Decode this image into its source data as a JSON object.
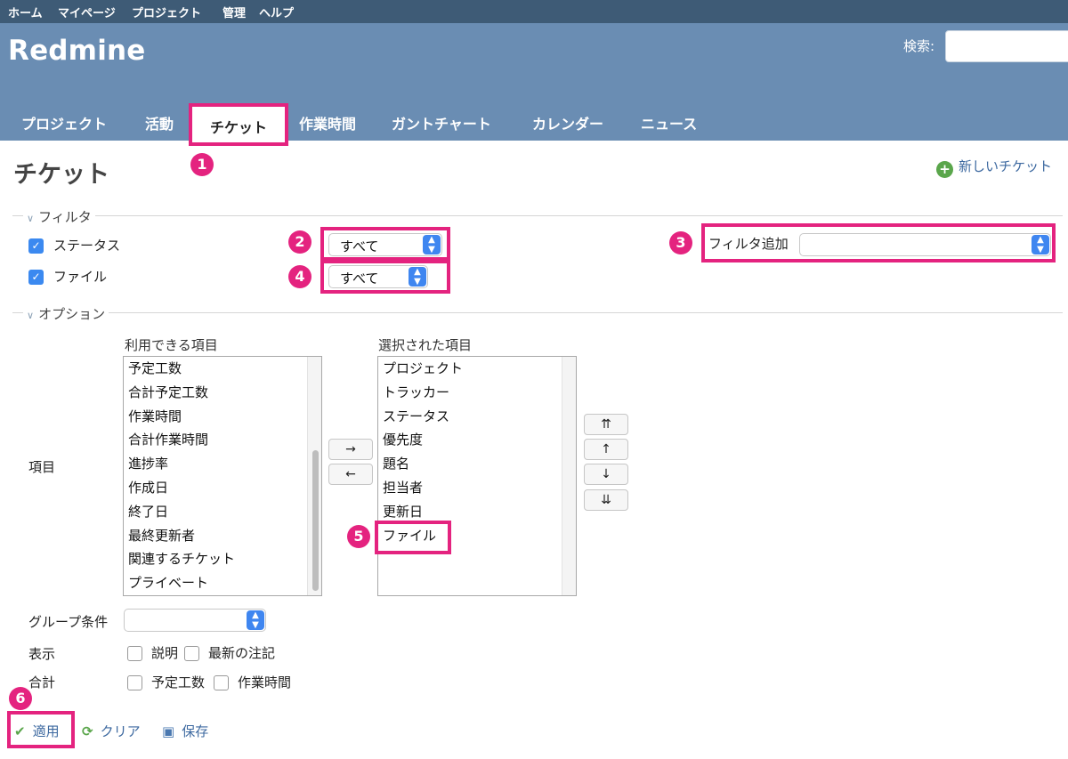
{
  "top_menu": {
    "home": "ホーム",
    "my_page": "マイページ",
    "projects": "プロジェクト",
    "admin": "管理",
    "help": "ヘルプ"
  },
  "header": {
    "title": "Redmine",
    "search_label": "検索:",
    "search_value": ""
  },
  "main_menu": {
    "projects": "プロジェクト",
    "activity": "活動",
    "issues": "チケット",
    "time_entries": "作業時間",
    "gantt": "ガントチャート",
    "calendar": "カレンダー",
    "news": "ニュース",
    "selected": "チケット"
  },
  "page": {
    "title": "チケット",
    "new_issue": "新しいチケット"
  },
  "filters": {
    "legend": "フィルタ",
    "status": {
      "label": "ステータス",
      "checked": true,
      "operator": "すべて"
    },
    "file": {
      "label": "ファイル",
      "checked": true,
      "operator": "すべて"
    },
    "add_filter_label": "フィルタ追加",
    "add_filter_value": ""
  },
  "options": {
    "legend": "オプション",
    "columns_label": "項目",
    "available_heading": "利用できる項目",
    "selected_heading": "選択された項目",
    "available": [
      "予定工数",
      "合計予定工数",
      "作業時間",
      "合計作業時間",
      "進捗率",
      "作成日",
      "終了日",
      "最終更新者",
      "関連するチケット",
      "プライベート"
    ],
    "selected": [
      "プロジェクト",
      "トラッカー",
      "ステータス",
      "優先度",
      "題名",
      "担当者",
      "更新日",
      "ファイル"
    ],
    "move_right": "→",
    "move_left": "←",
    "move_top": "⇈",
    "move_up": "↑",
    "move_down": "↓",
    "move_bottom": "⇊",
    "group_by_label": "グループ条件",
    "group_by_value": "",
    "show_label": "表示",
    "show_options": [
      {
        "label": "説明",
        "checked": false
      },
      {
        "label": "最新の注記",
        "checked": false
      }
    ],
    "totals_label": "合計",
    "totals_options": [
      {
        "label": "予定工数",
        "checked": false
      },
      {
        "label": "作業時間",
        "checked": false
      }
    ]
  },
  "actions": {
    "apply": "適用",
    "clear": "クリア",
    "save": "保存"
  },
  "callouts": [
    "1",
    "2",
    "3",
    "4",
    "5",
    "6"
  ],
  "colors": {
    "top_menu": "#3e5b76",
    "header": "#6a8db3",
    "highlight": "#e4237f",
    "link": "#3d69a0",
    "select_arrow": "#3f86f0"
  }
}
